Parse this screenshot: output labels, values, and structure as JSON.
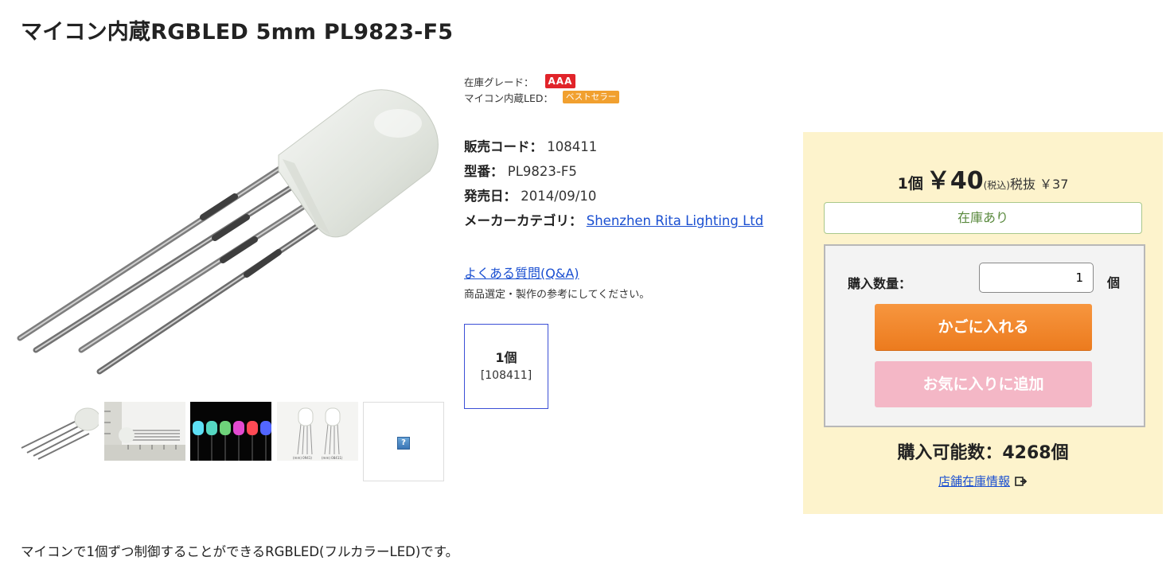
{
  "product": {
    "title": "マイコン内蔵RGBLED 5mm PL9823-F5",
    "grade_label": "在庫グレード：",
    "grade_value": "AAA",
    "category_label": "マイコン内蔵LED：",
    "category_badge": "ベストセラー",
    "specs": {
      "code_label": "販売コード：",
      "code_value": "108411",
      "model_label": "型番：",
      "model_value": "PL9823-F5",
      "release_label": "発売日：",
      "release_value": "2014/09/10",
      "maker_label": "メーカーカテゴリ：",
      "maker_value": "Shenzhen Rita Lighting Ltd"
    },
    "faq_link": "よくある質問(Q&A)",
    "faq_note": "商品選定・製作の参考にしてください。",
    "variant": {
      "qty": "1個",
      "code": "[108411]"
    },
    "description": "マイコンで1個ずつ制御することができるRGBLED(フルカラーLED)です。"
  },
  "purchase": {
    "unit": "1個",
    "price": "￥40",
    "tax_in": "(税込)",
    "tax_out": "税抜 ￥37",
    "stock_status": "在庫あり",
    "qty_label": "購入数量：",
    "qty_value": "1",
    "qty_unit": "個",
    "add_to_cart": "かごに入れる",
    "add_to_favorites": "お気に入りに追加",
    "available": "購入可能数：4268個",
    "store_stock_link": "店舗在庫情報"
  },
  "thumbnails": {
    "placeholder_glyph": "?",
    "labels": [
      "(mm) 0941)",
      "(mm) 08411)"
    ]
  },
  "colors": {
    "grade_badge": "#e1242a",
    "bestseller_badge": "#f1a02f",
    "link": "#1a4fd1",
    "panel_bg": "#fdf3cc",
    "cart_button": "#ec7b1e",
    "favorite_button": "#f4b7c6",
    "stock_border": "#a9c88b"
  }
}
